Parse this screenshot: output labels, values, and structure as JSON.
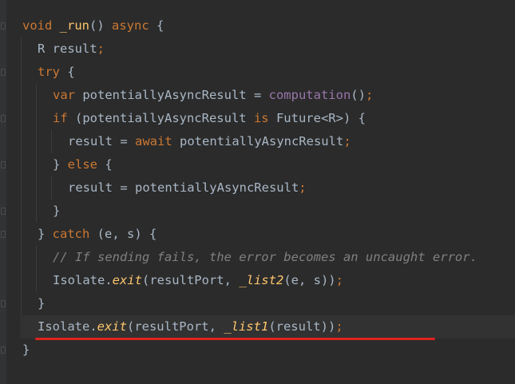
{
  "editor": {
    "lines": [
      {
        "indent": 0,
        "tokens": [
          {
            "t": "void",
            "c": "kw"
          },
          {
            "t": " ",
            "c": "plain"
          },
          {
            "t": "_run",
            "c": "fn"
          },
          {
            "t": "() ",
            "c": "plain"
          },
          {
            "t": "async",
            "c": "kw"
          },
          {
            "t": " {",
            "c": "plain"
          }
        ]
      },
      {
        "indent": 1,
        "tokens": [
          {
            "t": "R result",
            "c": "plain"
          },
          {
            "t": ";",
            "c": "kw"
          }
        ]
      },
      {
        "indent": 1,
        "tokens": [
          {
            "t": "try",
            "c": "kw"
          },
          {
            "t": " {",
            "c": "plain"
          }
        ]
      },
      {
        "indent": 2,
        "tokens": [
          {
            "t": "var",
            "c": "kw"
          },
          {
            "t": " potentiallyAsyncResult = ",
            "c": "plain"
          },
          {
            "t": "computation",
            "c": "purple"
          },
          {
            "t": "()",
            "c": "plain"
          },
          {
            "t": ";",
            "c": "kw"
          }
        ]
      },
      {
        "indent": 2,
        "tokens": [
          {
            "t": "if",
            "c": "kw"
          },
          {
            "t": " (potentiallyAsyncResult ",
            "c": "plain"
          },
          {
            "t": "is",
            "c": "kw"
          },
          {
            "t": " Future<R>) {",
            "c": "plain"
          }
        ]
      },
      {
        "indent": 3,
        "tokens": [
          {
            "t": "result = ",
            "c": "plain"
          },
          {
            "t": "await",
            "c": "kw"
          },
          {
            "t": " potentiallyAsyncResult",
            "c": "plain"
          },
          {
            "t": ";",
            "c": "kw"
          }
        ]
      },
      {
        "indent": 2,
        "tokens": [
          {
            "t": "} ",
            "c": "plain"
          },
          {
            "t": "else",
            "c": "kw"
          },
          {
            "t": " {",
            "c": "plain"
          }
        ]
      },
      {
        "indent": 3,
        "tokens": [
          {
            "t": "result = potentiallyAsyncResult",
            "c": "plain"
          },
          {
            "t": ";",
            "c": "kw"
          }
        ]
      },
      {
        "indent": 2,
        "tokens": [
          {
            "t": "}",
            "c": "plain"
          }
        ]
      },
      {
        "indent": 1,
        "tokens": [
          {
            "t": "} ",
            "c": "plain"
          },
          {
            "t": "catch",
            "c": "kw"
          },
          {
            "t": " (e, s) {",
            "c": "plain"
          }
        ]
      },
      {
        "indent": 2,
        "tokens": [
          {
            "t": "// If sending fails, the error becomes an uncaught error.",
            "c": "cm"
          }
        ]
      },
      {
        "indent": 2,
        "tokens": [
          {
            "t": "Isolate.",
            "c": "plain"
          },
          {
            "t": "exit",
            "c": "ital"
          },
          {
            "t": "(resultPort, ",
            "c": "plain"
          },
          {
            "t": "_list2",
            "c": "ital"
          },
          {
            "t": "(e, s))",
            "c": "plain"
          },
          {
            "t": ";",
            "c": "kw"
          }
        ]
      },
      {
        "indent": 1,
        "tokens": [
          {
            "t": "}",
            "c": "plain"
          }
        ]
      },
      {
        "indent": 1,
        "highlight": true,
        "tokens": [
          {
            "t": "Isolate.",
            "c": "plain"
          },
          {
            "t": "exit",
            "c": "ital"
          },
          {
            "t": "(resultPort, ",
            "c": "plain"
          },
          {
            "t": "_list1",
            "c": "ital"
          },
          {
            "t": "(result))",
            "c": "plain"
          },
          {
            "t": ";",
            "c": "kw"
          }
        ]
      },
      {
        "indent": 0,
        "tokens": [
          {
            "t": "}",
            "c": "plain"
          }
        ]
      }
    ]
  },
  "colors": {
    "background": "#2b2b2b",
    "keyword": "#cc7832",
    "function": "#ffc66d",
    "identifier": "#a9b7c6",
    "purple": "#9876aa",
    "comment": "#808080",
    "annotation_underline": "#e0221c"
  }
}
